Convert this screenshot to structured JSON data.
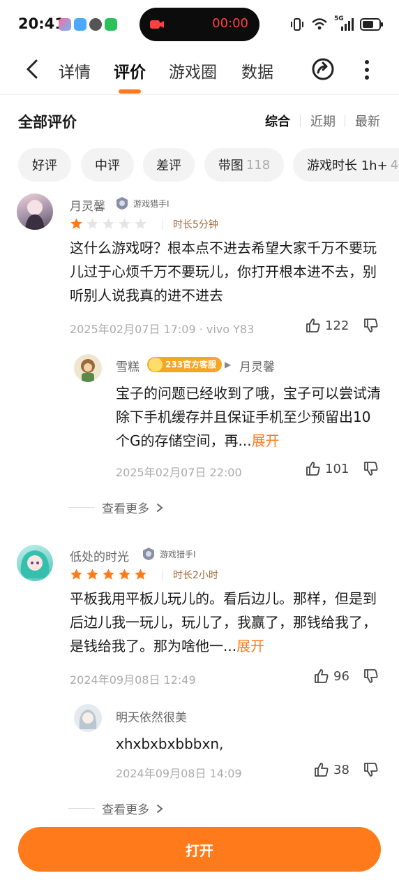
{
  "status_bar": {
    "time": "20:41",
    "recording_time": "00:00",
    "network": "5G"
  },
  "nav": {
    "tabs": [
      {
        "label": "详情"
      },
      {
        "label": "评价"
      },
      {
        "label": "游戏圈"
      },
      {
        "label": "数据"
      }
    ],
    "active_tab": "评价"
  },
  "section": {
    "title": "全部评价",
    "sort_options": [
      "综合",
      "近期",
      "最新"
    ],
    "active_sort": "综合"
  },
  "filters": [
    {
      "label": "好评",
      "count": ""
    },
    {
      "label": "中评",
      "count": ""
    },
    {
      "label": "差评",
      "count": ""
    },
    {
      "label": "带图",
      "count": "118"
    },
    {
      "label": "游戏时长 1h+",
      "count": "4"
    }
  ],
  "reviews": [
    {
      "username": "月灵馨",
      "badge": "游戏猎手I",
      "rating": 1,
      "duration": "时长5分钟",
      "text": "这什么游戏呀？根本点不进去希望大家千万不要玩儿过于心烦千万不要玩儿，你打开根本进不去，别听别人说我真的进不进去",
      "meta": "2025年02月07日 17:09 · vivo Y83",
      "likes": "122",
      "reply": {
        "username": "雪糕",
        "badge": "233官方客服",
        "reply_to": "月灵馨",
        "text": "宝子的问题已经收到了哦，宝子可以尝试清除下手机缓存并且保证手机至少预留出10个G的存储空间，再...",
        "expand_label": "展开",
        "meta": "2025年02月07日 22:00",
        "likes": "101"
      },
      "see_more": "查看更多"
    },
    {
      "username": "低处的时光",
      "badge": "游戏猎手I",
      "rating": 5,
      "duration": "时长2小时",
      "text": "平板我用平板儿玩儿的。看后边儿。那样，但是到后边儿我一玩儿，玩儿了，我赢了，那钱给我了，是钱给我了。那为啥他一...",
      "expand_label": "展开",
      "meta": "2024年09月08日 12:49",
      "likes": "96",
      "reply": {
        "username": "明天依然很美",
        "text": "xhxbxbxbbbxn,",
        "meta": "2024年09月08日 14:09",
        "likes": "38"
      },
      "see_more": "查看更多"
    }
  ],
  "open_button": "打开",
  "colors": {
    "accent": "#ff7a1a",
    "star_filled": "#ff7a1a",
    "star_empty": "#e5e5e5",
    "duration_text": "#a0673a"
  }
}
